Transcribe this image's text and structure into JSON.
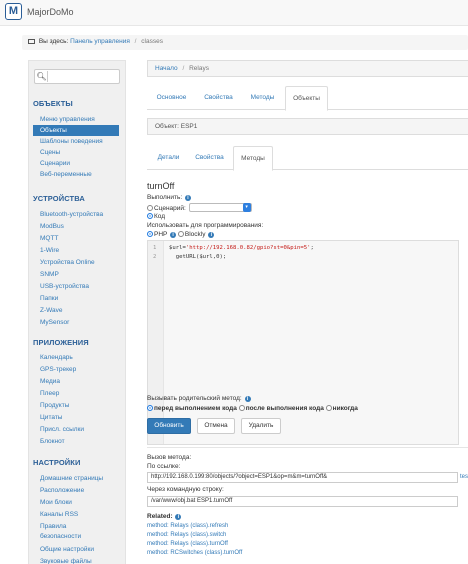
{
  "app": {
    "title": "MajorDoMo",
    "logo_letter": "M"
  },
  "breadcrumb": {
    "prefix": "Вы здесь:",
    "home": "Панель управления",
    "current": "classes"
  },
  "sidebar": {
    "search_placeholder": "",
    "sections": [
      {
        "title": "ОБЪЕКТЫ",
        "items": [
          "Меню управления",
          "Объекты",
          "Шаблоны поведения",
          "Сцены",
          "Сценарии",
          "Веб-переменные"
        ]
      },
      {
        "title": "УСТРОЙСТВА",
        "items": [
          "Bluetooth-устройства",
          "ModBus",
          "MQTT",
          "1-Wire",
          "Устройства Online",
          "SNMP",
          "USB-устройства",
          "Папки",
          "Z-Wave",
          "MySensor"
        ]
      },
      {
        "title": "ПРИЛОЖЕНИЯ",
        "items": [
          "Календарь",
          "GPS-трекер",
          "Медиа",
          "Плеер",
          "Продукты",
          "Цитаты",
          "Присл. ссылки",
          "Блокнот"
        ]
      },
      {
        "title": "НАСТРОЙКИ",
        "items": [
          "Домашние страницы",
          "Расположение",
          "Мои блоки",
          "Каналы RSS",
          "Правила",
          "безопасности",
          "Общие настройки",
          "Звуковые файлы"
        ]
      }
    ],
    "active_item": "Объекты"
  },
  "main": {
    "crumb": {
      "home": "Начало",
      "current": "Relays"
    },
    "class_tabs": [
      "Основное",
      "Свойства",
      "Методы",
      "Объекты"
    ],
    "class_tab_active": "Объекты",
    "object_header": "Объект: ESP1",
    "object_tabs": [
      "Детали",
      "Свойства",
      "Методы"
    ],
    "object_tab_active": "Методы",
    "method_title": "turnOff",
    "execute_label": "Выполнить:",
    "scenario_label": "Сценарий:",
    "code_label": "Код",
    "use_for_programming": "Использовать для программирования:",
    "lang_php": "PHP",
    "lang_blockly": "Blockly",
    "code_lines": [
      {
        "num": "1",
        "parts": [
          "$url",
          "=",
          "'http://192.168.0.82/gpio?st=0&pin=5'",
          ";"
        ]
      },
      {
        "num": "2",
        "parts": [
          "  getURL(",
          "$url",
          ",0);"
        ]
      }
    ],
    "parent_method_label": "Вызывать родительский метод:",
    "parent_options": [
      "перед выполнением кода",
      "после выполнения кода",
      "никогда"
    ],
    "buttons": {
      "update": "Обновить",
      "cancel": "Отмена",
      "delete": "Удалить"
    },
    "call_method_label": "Вызов метода:",
    "by_link_label": "По ссылке:",
    "link_value": "http://192.168.0.199:80/objects/?object=ESP1&op=m&m=turnOff&",
    "link_suffix": "tes",
    "cmd_label": "Через командную строку:",
    "cmd_value": "/var/www/obj.bat ESP1.turnOff",
    "related_label": "Related:",
    "related_links": [
      "method: Relays (class).refresh",
      "method: Relays (class).switch",
      "method: Relays (class).turnOff",
      "method: RCSwitches (class).turnOff"
    ]
  },
  "colors": {
    "accent": "#337ab7",
    "section": "#2b5f97",
    "string": "#c41a16"
  }
}
